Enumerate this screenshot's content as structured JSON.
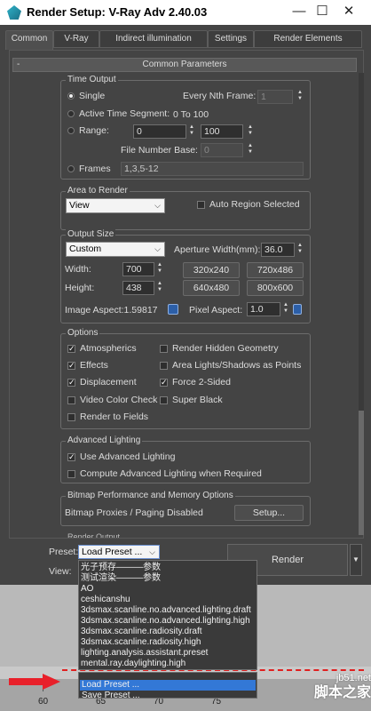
{
  "window": {
    "title": "Render Setup: V-Ray Adv 2.40.03",
    "minimize": "—",
    "maximize": "☐",
    "close": "✕"
  },
  "tabs": [
    "Common",
    "V-Ray",
    "Indirect illumination",
    "Settings",
    "Render Elements"
  ],
  "rollout": {
    "minus": "-",
    "title": "Common Parameters"
  },
  "time_output": {
    "title": "Time Output",
    "single": "Single",
    "every_nth_label": "Every Nth Frame:",
    "every_nth_value": "1",
    "active_segment": "Active Time Segment:",
    "active_range": "0 To 100",
    "range": "Range:",
    "range_from": "0",
    "range_to_label": "To",
    "range_to": "100",
    "file_number_base_label": "File Number Base:",
    "file_number_base_value": "0",
    "frames": "Frames",
    "frames_value": "1,3,5-12"
  },
  "area_to_render": {
    "title": "Area to Render",
    "selected": "View",
    "auto_region": "Auto Region Selected"
  },
  "output_size": {
    "title": "Output Size",
    "preset": "Custom",
    "aperture_label": "Aperture Width(mm):",
    "aperture_value": "36.0",
    "width_label": "Width:",
    "width_value": "700",
    "height_label": "Height:",
    "height_value": "438",
    "presets": [
      "320x240",
      "720x486",
      "640x480",
      "800x600"
    ],
    "image_aspect": "Image Aspect:1.59817",
    "pixel_aspect_label": "Pixel Aspect:",
    "pixel_aspect_value": "1.0"
  },
  "options": {
    "title": "Options",
    "items": [
      {
        "label": "Atmospherics",
        "checked": true
      },
      {
        "label": "Render Hidden Geometry",
        "checked": false
      },
      {
        "label": "Effects",
        "checked": true
      },
      {
        "label": "Area Lights/Shadows as Points",
        "checked": false
      },
      {
        "label": "Displacement",
        "checked": true
      },
      {
        "label": "Force 2-Sided",
        "checked": true
      },
      {
        "label": "Video Color Check",
        "checked": false
      },
      {
        "label": "Super Black",
        "checked": false
      },
      {
        "label": "Render to Fields",
        "checked": false
      }
    ]
  },
  "advanced_lighting": {
    "title": "Advanced Lighting",
    "use": "Use Advanced Lighting",
    "compute": "Compute Advanced Lighting when Required"
  },
  "bitmap": {
    "title": "Bitmap Performance and Memory Options",
    "status": "Bitmap Proxies / Paging Disabled",
    "setup": "Setup..."
  },
  "render_output": {
    "title": "Render Output"
  },
  "footer": {
    "preset_label": "Preset:",
    "preset_value": "Load Preset ...",
    "view_label": "View:",
    "render": "Render",
    "render_menu": "▼"
  },
  "preset_menu": [
    "光子预存———参数",
    "测试渲染———参数",
    "AO",
    "ceshicanshu",
    "3dsmax.scanline.no.advanced.lighting.draft",
    "3dsmax.scanline.no.advanced.lighting.high",
    "3dsmax.scanline.radiosity.draft",
    "3dsmax.scanline.radiosity.high",
    "lighting.analysis.assistant.preset",
    "mental.ray.daylighting.high"
  ],
  "preset_actions": [
    "Load Preset ...",
    "Save Preset ..."
  ],
  "timeline": {
    "ticks": [
      "60",
      "65",
      "70",
      "75"
    ]
  },
  "watermark": {
    "line1": "jb51.net",
    "line2": "脚本之家"
  }
}
